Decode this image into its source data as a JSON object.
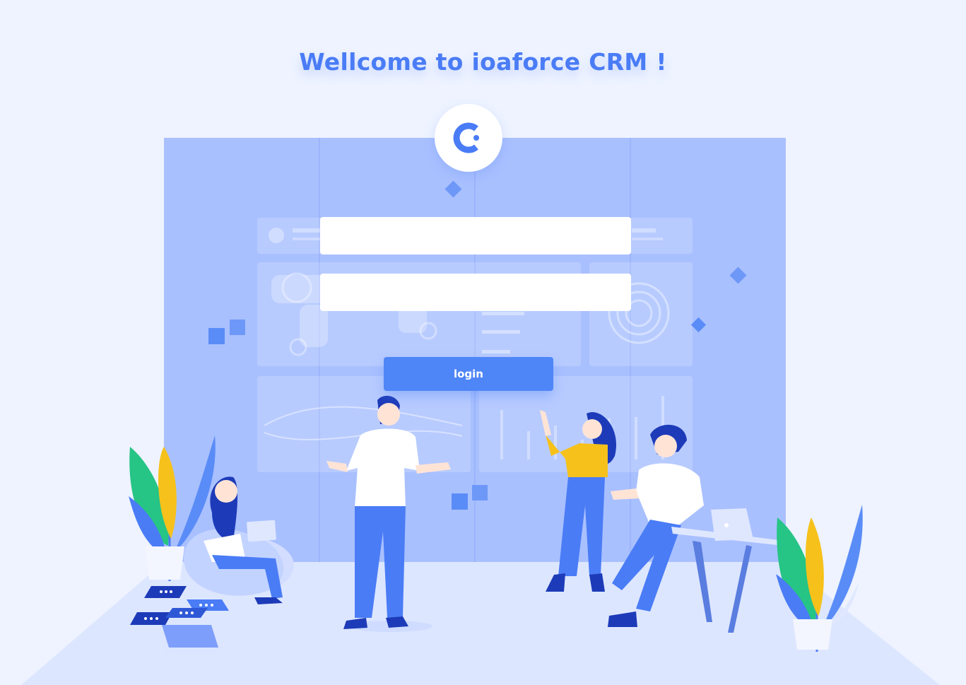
{
  "page": {
    "title": "Wellcome to ioaforce CRM !"
  },
  "logo": {
    "icon": "ioaforce-logo-icon"
  },
  "form": {
    "username": {
      "value": "",
      "placeholder": ""
    },
    "password": {
      "value": "",
      "placeholder": ""
    },
    "login_label": "login"
  },
  "colors": {
    "background": "#eef3ff",
    "wall": "#a9c0ff",
    "accent": "#4f86f7",
    "title": "#4a7cf6"
  }
}
